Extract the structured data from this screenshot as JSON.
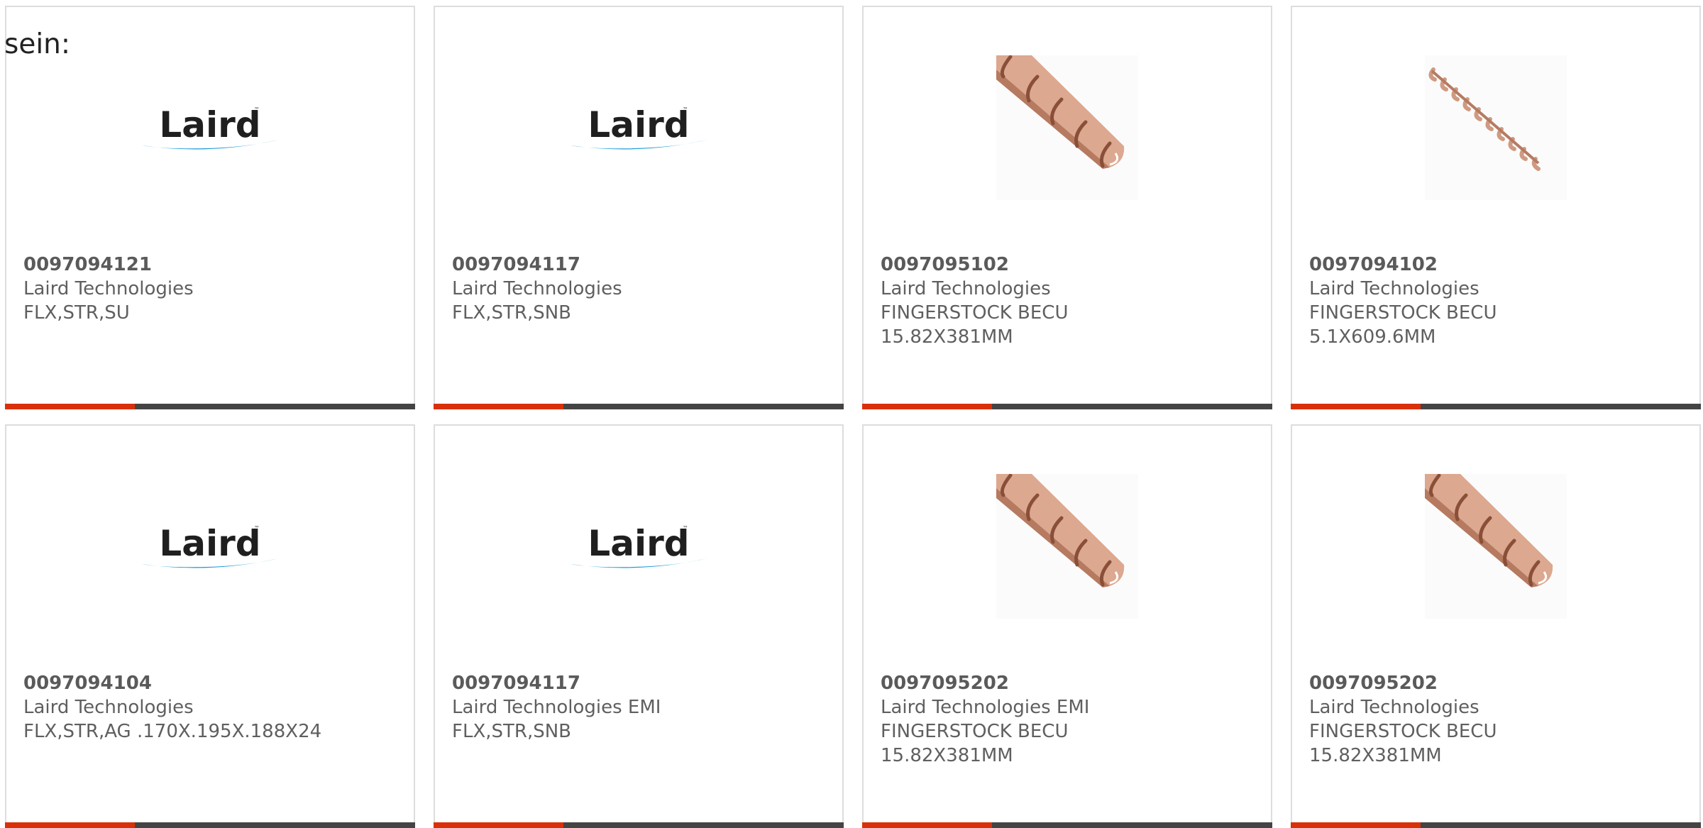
{
  "intro_text": "sein:",
  "colors": {
    "accent_bar": "#d9300a",
    "base_bar": "#444444",
    "laird_swoosh": "#1e9bd7"
  },
  "brand": {
    "logo_text": "Laird"
  },
  "products": [
    {
      "part_number": "0097094121",
      "manufacturer": "Laird Technologies",
      "desc_line1": "FLX,STR,SU",
      "desc_line2": "",
      "image": "laird-logo"
    },
    {
      "part_number": "0097094117",
      "manufacturer": "Laird Technologies",
      "desc_line1": "FLX,STR,SNB",
      "desc_line2": "",
      "image": "laird-logo"
    },
    {
      "part_number": "0097095102",
      "manufacturer": "Laird Technologies",
      "desc_line1": "FINGERSTOCK BECU",
      "desc_line2": "15.82X381MM",
      "image": "fingerstock-wide-photo"
    },
    {
      "part_number": "0097094102",
      "manufacturer": "Laird Technologies",
      "desc_line1": "FINGERSTOCK BECU",
      "desc_line2": "5.1X609.6MM",
      "image": "fingerstock-narrow-photo"
    },
    {
      "part_number": "0097094104",
      "manufacturer": "Laird Technologies",
      "desc_line1": "FLX,STR,AG .170X.195X.188X24",
      "desc_line2": "",
      "image": "laird-logo"
    },
    {
      "part_number": "0097094117",
      "manufacturer": "Laird Technologies EMI",
      "desc_line1": "FLX,STR,SNB",
      "desc_line2": "",
      "image": "laird-logo"
    },
    {
      "part_number": "0097095202",
      "manufacturer": "Laird Technologies EMI",
      "desc_line1": "FINGERSTOCK BECU",
      "desc_line2": "15.82X381MM",
      "image": "fingerstock-wide-photo"
    },
    {
      "part_number": "0097095202",
      "manufacturer": "Laird Technologies",
      "desc_line1": "FINGERSTOCK BECU",
      "desc_line2": "15.82X381MM",
      "image": "fingerstock-wide-photo"
    }
  ]
}
